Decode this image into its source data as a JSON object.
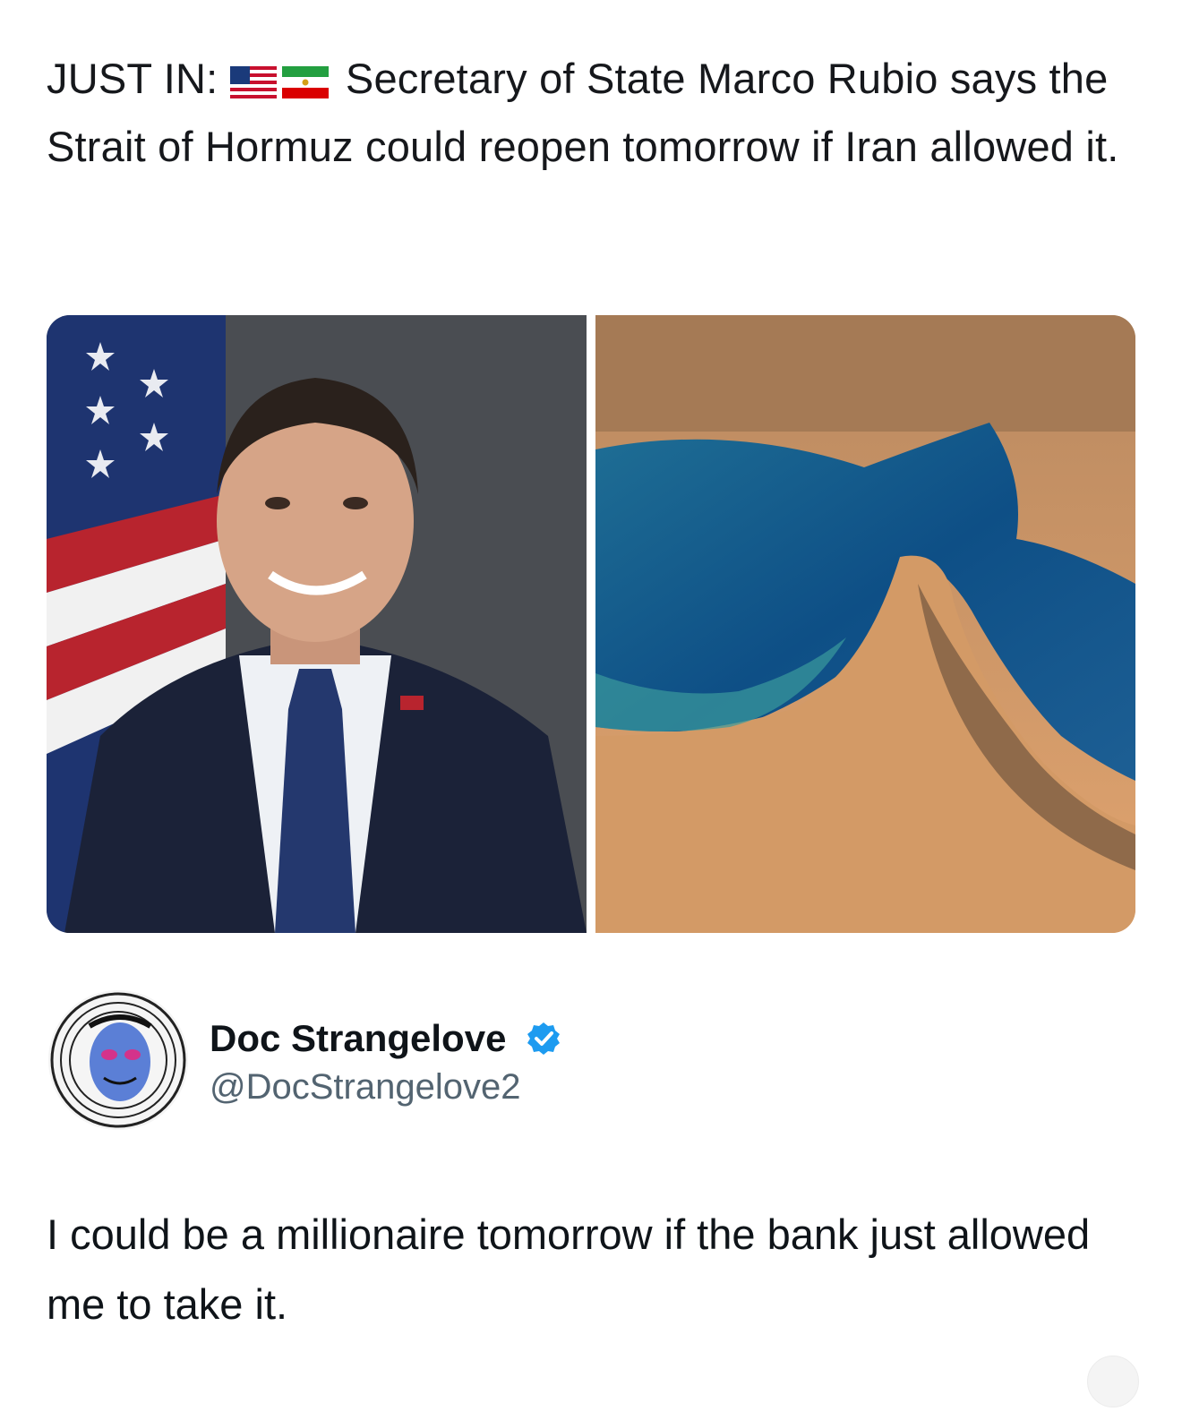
{
  "post": {
    "headline_prefix": "JUST IN:",
    "headline_text": "Secretary of State Marco Rubio says the Strait of Hormuz could reopen tomorrow if Iran allowed it.",
    "flags": [
      "us-flag-icon",
      "iran-flag-icon"
    ]
  },
  "media": {
    "images": [
      {
        "name": "portrait-photo"
      },
      {
        "name": "satellite-map-photo"
      }
    ]
  },
  "reply": {
    "author_name": "Doc Strangelove",
    "author_handle": "@DocStrangelove2",
    "verified": true,
    "text": "I could be a millionaire tomorrow if the bank just allowed me to take it."
  },
  "colors": {
    "text": "#0f1419",
    "handle": "#536471",
    "verified": "#1d9bf0"
  }
}
